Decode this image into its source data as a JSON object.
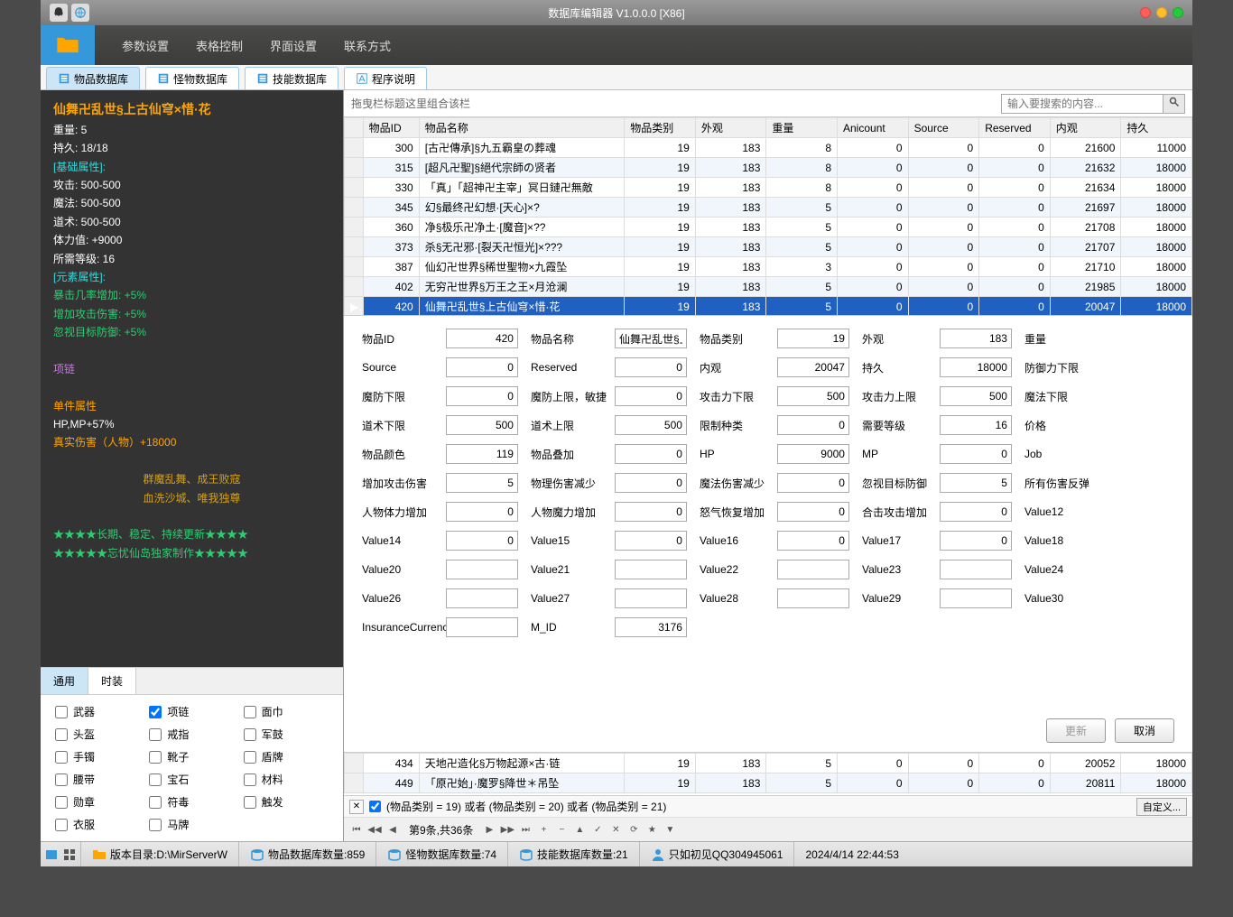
{
  "title": "数据库编辑器 V1.0.0.0 [X86]",
  "ribbon": {
    "tabs": [
      "参数设置",
      "表格控制",
      "界面设置",
      "联系方式"
    ]
  },
  "main_tabs": [
    {
      "label": "物品数据库",
      "active": true
    },
    {
      "label": "怪物数据库"
    },
    {
      "label": "技能数据库"
    },
    {
      "label": "程序说明"
    }
  ],
  "item_detail": {
    "title": "仙舞卍乱世§上古仙穹×惜·花",
    "weight": "重量: 5",
    "dura": "持久: 18/18",
    "base_hdr": "[基础属性]:",
    "atk": "攻击:      500-500",
    "mag": "魔法:      500-500",
    "tao": "道术:      500-500",
    "hp": "体力值:     +9000",
    "lvl": "所需等级: 16",
    "elem_hdr": "[元素属性]:",
    "crit": "暴击几率增加: +5%",
    "atkinc": "增加攻击伤害: +5%",
    "ignore": "忽视目标防御: +5%",
    "necklace": "项链",
    "single_hdr": "单件属性",
    "hpmp": "HP,MP+57%",
    "truedmg": "真实伤害（人物）+18000",
    "flav1": "群魔乱舞、成王败寇",
    "flav2": "血洗沙城、唯我独尊",
    "star1": "★★★★长期、稳定、持续更新★★★★",
    "star2": "★★★★★忘忧仙岛独家制作★★★★★"
  },
  "left_tabs": {
    "t1": "通用",
    "t2": "时装"
  },
  "filters": [
    "武器",
    "项链",
    "面巾",
    "头盔",
    "戒指",
    "军鼓",
    "手镯",
    "靴子",
    "盾牌",
    "腰带",
    "宝石",
    "材料",
    "勋章",
    "符毒",
    "触发",
    "衣服",
    "马牌"
  ],
  "filter_checked_idx": 1,
  "search": {
    "hint": "拖曳栏标题这里组合该栏",
    "placeholder": "输入要搜索的内容..."
  },
  "grid": {
    "columns": [
      "物品ID",
      "物品名称",
      "物品类别",
      "外观",
      "重量",
      "Anicount",
      "Source",
      "Reserved",
      "内观",
      "持久"
    ],
    "rows": [
      [
        300,
        "[古卍傳承]§九五霸皇の葬魂",
        19,
        183,
        8,
        0,
        0,
        0,
        21600,
        11000
      ],
      [
        315,
        "[超凡卍聖]§絕代宗師の贤者",
        19,
        183,
        8,
        0,
        0,
        0,
        21632,
        18000
      ],
      [
        330,
        "「真」「超神卍主宰」冥日鏈卍無敵",
        19,
        183,
        8,
        0,
        0,
        0,
        21634,
        18000
      ],
      [
        345,
        "幻§最终卍幻想·[天心]×?",
        19,
        183,
        5,
        0,
        0,
        0,
        21697,
        18000
      ],
      [
        360,
        "净§极乐卍净土·[魔音]×??",
        19,
        183,
        5,
        0,
        0,
        0,
        21708,
        18000
      ],
      [
        373,
        "杀§无卍邪·[裂天卍恒光]×???",
        19,
        183,
        5,
        0,
        0,
        0,
        21707,
        18000
      ],
      [
        387,
        "仙幻卍世界§稀世聖物×九霞坠",
        19,
        183,
        3,
        0,
        0,
        0,
        21710,
        18000
      ],
      [
        402,
        "无穷卍世界§万王之王×月沧澜",
        19,
        183,
        5,
        0,
        0,
        0,
        21985,
        18000
      ],
      [
        420,
        "仙舞卍乱世§上古仙穹×惜·花",
        19,
        183,
        5,
        0,
        0,
        0,
        20047,
        18000
      ]
    ],
    "rows2": [
      [
        434,
        "天地卍造化§万物起源×古·链",
        19,
        183,
        5,
        0,
        0,
        0,
        20052,
        18000
      ],
      [
        449,
        "「原卍始」·魔罗§降世＊吊坠",
        19,
        183,
        5,
        0,
        0,
        0,
        20811,
        18000
      ]
    ],
    "selected_row": 8
  },
  "form": {
    "fields": [
      [
        "物品ID",
        "420"
      ],
      [
        "物品名称",
        "仙舞卍乱世§上"
      ],
      [
        "物品类别",
        "19"
      ],
      [
        "外观",
        "183"
      ],
      [
        "重量",
        ""
      ],
      [
        "Source",
        "0"
      ],
      [
        "Reserved",
        "0"
      ],
      [
        "内观",
        "20047"
      ],
      [
        "持久",
        "18000"
      ],
      [
        "防御力下限",
        ""
      ],
      [
        "魔防下限",
        "0"
      ],
      [
        "魔防上限，敏捷",
        "0"
      ],
      [
        "攻击力下限",
        "500"
      ],
      [
        "攻击力上限",
        "500"
      ],
      [
        "魔法下限",
        ""
      ],
      [
        "道术下限",
        "500"
      ],
      [
        "道术上限",
        "500"
      ],
      [
        "限制种类",
        "0"
      ],
      [
        "需要等级",
        "16"
      ],
      [
        "价格",
        ""
      ],
      [
        "物品颜色",
        "119"
      ],
      [
        "物品叠加",
        "0"
      ],
      [
        "HP",
        "9000"
      ],
      [
        "MP",
        "0"
      ],
      [
        "Job",
        ""
      ],
      [
        "增加攻击伤害",
        "5"
      ],
      [
        "物理伤害减少",
        "0"
      ],
      [
        "魔法伤害减少",
        "0"
      ],
      [
        "忽视目标防御",
        "5"
      ],
      [
        "所有伤害反弹",
        ""
      ],
      [
        "人物体力增加",
        "0"
      ],
      [
        "人物魔力增加",
        "0"
      ],
      [
        "怒气恢复增加",
        "0"
      ],
      [
        "合击攻击增加",
        "0"
      ],
      [
        "Value12",
        ""
      ],
      [
        "Value14",
        "0"
      ],
      [
        "Value15",
        "0"
      ],
      [
        "Value16",
        "0"
      ],
      [
        "Value17",
        "0"
      ],
      [
        "Value18",
        ""
      ],
      [
        "Value20",
        ""
      ],
      [
        "Value21",
        ""
      ],
      [
        "Value22",
        ""
      ],
      [
        "Value23",
        ""
      ],
      [
        "Value24",
        ""
      ],
      [
        "Value26",
        ""
      ],
      [
        "Value27",
        ""
      ],
      [
        "Value28",
        ""
      ],
      [
        "Value29",
        ""
      ],
      [
        "Value30",
        ""
      ],
      [
        "InsuranceCurrency",
        ""
      ],
      [
        "M_ID",
        "3176"
      ]
    ],
    "btn_update": "更新",
    "btn_cancel": "取消"
  },
  "filter_expr": "(物品类别 = 19) 或者 (物品类别 = 20) 或者 (物品类别 = 21)",
  "custom_btn": "自定义...",
  "nav_text": "第9条,共36条",
  "status": {
    "path": "版本目录:D:\\MirServerW",
    "s1": "物品数据库数量:859",
    "s2": "怪物数据库数量:74",
    "s3": "技能数据库数量:21",
    "s4": "只如初见QQ304945061",
    "s5": "2024/4/14 22:44:53"
  }
}
